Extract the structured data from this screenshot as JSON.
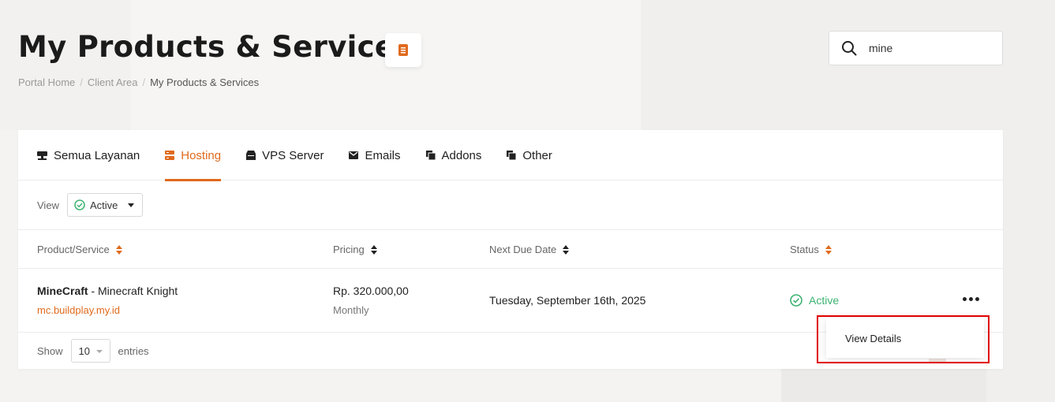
{
  "page": {
    "title": "My Products & Services",
    "breadcrumb": [
      "Portal Home",
      "Client Area",
      "My Products & Services"
    ]
  },
  "search": {
    "value": "mine"
  },
  "tabs": [
    {
      "label": "Semua Layanan",
      "icon": "server-icon",
      "active": false
    },
    {
      "label": "Hosting",
      "icon": "hosting-icon",
      "active": true
    },
    {
      "label": "VPS Server",
      "icon": "vps-icon",
      "active": false
    },
    {
      "label": "Emails",
      "icon": "mail-icon",
      "active": false
    },
    {
      "label": "Addons",
      "icon": "addons-icon",
      "active": false
    },
    {
      "label": "Other",
      "icon": "other-icon",
      "active": false
    }
  ],
  "filter": {
    "view_label": "View",
    "view_value": "Active"
  },
  "table": {
    "headers": [
      "Product/Service",
      "Pricing",
      "Next Due Date",
      "Status"
    ],
    "rows": [
      {
        "product": "MineCraft",
        "product_suffix": " - Minecraft Knight",
        "domain": "mc.buildplay.my.id",
        "price": "Rp. 320.000,00",
        "cycle": "Monthly",
        "due": "Tuesday, September 16th, 2025",
        "status": "Active"
      }
    ]
  },
  "pagination": {
    "show_label": "Show",
    "length": "10",
    "entries_label": "entries"
  },
  "dropdown": {
    "view_details": "View Details"
  },
  "colors": {
    "accent": "#e06a1d",
    "active": "#3cb371",
    "highlight": "#e00000"
  }
}
